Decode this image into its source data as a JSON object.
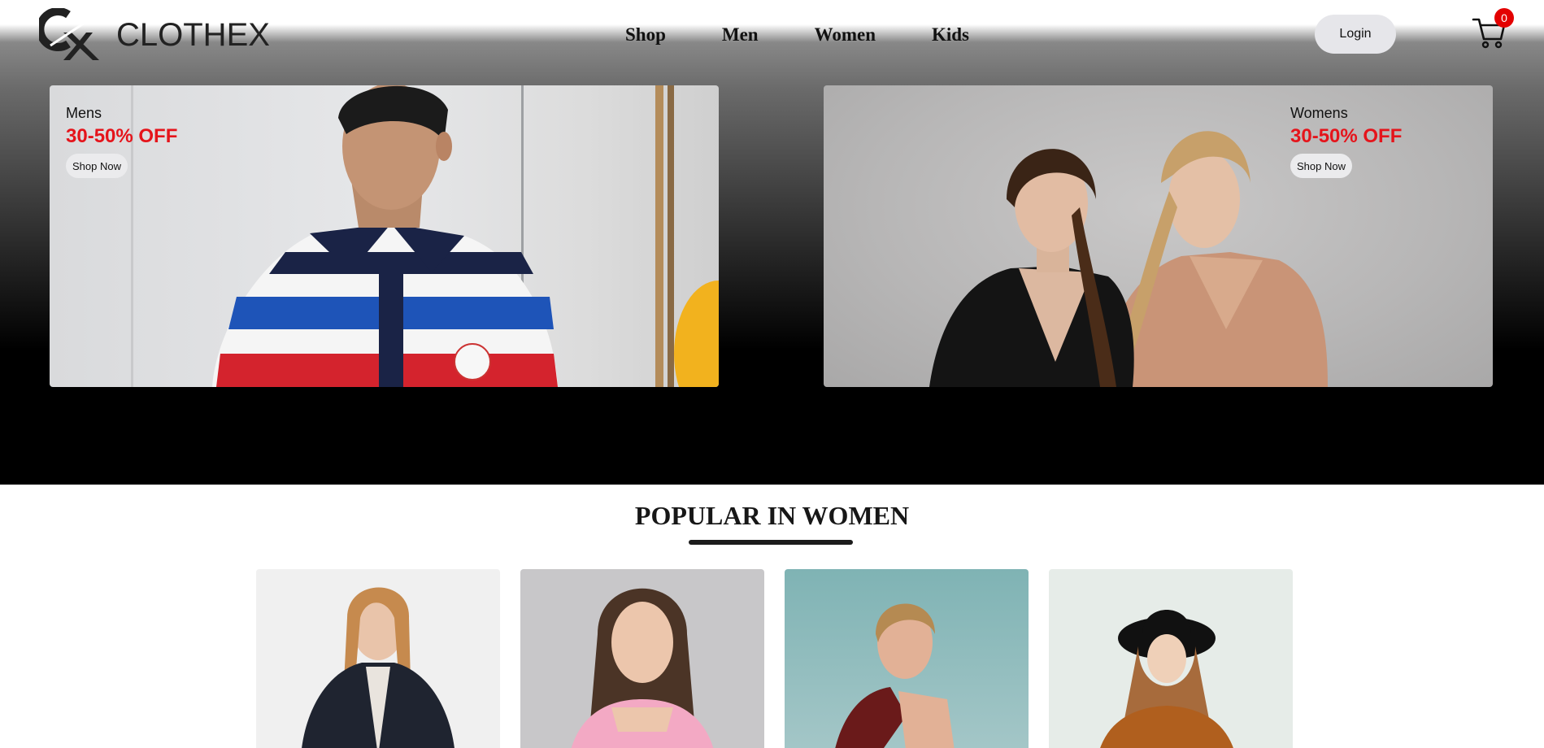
{
  "brand": {
    "name": "CLOTHEX",
    "logo_text": "CX"
  },
  "nav": [
    {
      "label": "Shop"
    },
    {
      "label": "Men"
    },
    {
      "label": "Women"
    },
    {
      "label": "Kids"
    }
  ],
  "header": {
    "login_label": "Login",
    "cart_count": "0",
    "cart_icon": "cart-icon"
  },
  "banners": {
    "men": {
      "label": "Mens",
      "offer": "30-50% OFF",
      "button": "Shop Now"
    },
    "women": {
      "label": "Womens",
      "offer": "30-50% OFF",
      "button": "Shop Now"
    }
  },
  "popular": {
    "title": "POPULAR IN WOMEN"
  },
  "colors": {
    "accent_red": "#e5141b",
    "badge_red": "#e30000",
    "dark": "#000000"
  }
}
